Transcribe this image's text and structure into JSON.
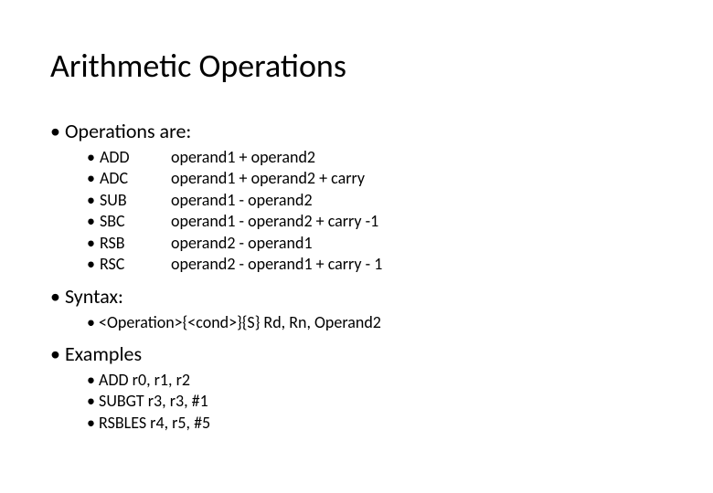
{
  "title": "Arithmetic Operations",
  "sections": {
    "operations": {
      "heading": "Operations are:",
      "items": [
        {
          "mnemonic": "ADD",
          "desc": "operand1 + operand2"
        },
        {
          "mnemonic": "ADC",
          "desc": "operand1 + operand2 + carry"
        },
        {
          "mnemonic": "SUB",
          "desc": "operand1 - operand2"
        },
        {
          "mnemonic": "SBC",
          "desc": "operand1 - operand2 + carry -1"
        },
        {
          "mnemonic": "RSB",
          "desc": "operand2 - operand1"
        },
        {
          "mnemonic": "RSC",
          "desc": "operand2 - operand1 + carry - 1"
        }
      ]
    },
    "syntax": {
      "heading": "Syntax:",
      "line": "<Operation>{<cond>}{S} Rd, Rn, Operand2"
    },
    "examples": {
      "heading": "Examples",
      "items": [
        "ADD r0, r1, r2",
        "SUBGT r3, r3, #1",
        "RSBLES r4, r5, #5"
      ]
    }
  }
}
